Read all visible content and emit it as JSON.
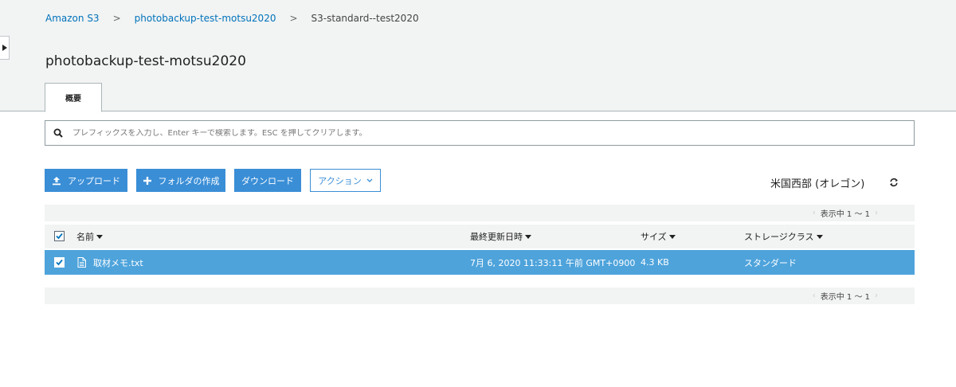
{
  "breadcrumb": {
    "root": "Amazon S3",
    "bucket": "photobackup-test-motsu2020",
    "folder": "S3-standard--test2020",
    "separator": ">"
  },
  "page": {
    "title": "photobackup-test-motsu2020",
    "tab_overview": "概要"
  },
  "search": {
    "placeholder": "プレフィックスを入力し、Enter キーで検索します。ESC を押してクリアします。",
    "value": ""
  },
  "toolbar": {
    "upload_label": "アップロード",
    "create_folder_label": "フォルダの作成",
    "download_label": "ダウンロード",
    "action_label": "アクション",
    "region_label": "米国西部 (オレゴン)"
  },
  "pagination": {
    "top": "表示中 1 ～ 1",
    "bottom": "表示中 1 ～ 1"
  },
  "table": {
    "columns": {
      "name": "名前",
      "last_modified": "最終更新日時",
      "size": "サイズ",
      "storage_class": "ストレージクラス"
    },
    "rows": [
      {
        "name": "取材メモ.txt",
        "last_modified": "7月 6, 2020 11:33:11 午前 GMT+0900",
        "size": "4.3 KB",
        "storage_class": "スタンダード",
        "selected": true
      }
    ]
  },
  "colors": {
    "primary": "#3a8ed6",
    "selected_row": "#4ea3db",
    "link": "#0073bb",
    "header_bg": "#f2f3f3"
  },
  "icons": {
    "search": "search-icon",
    "upload": "upload-icon",
    "add": "plus-icon",
    "refresh": "refresh-icon",
    "file": "file-icon",
    "expand": "caret-right-icon"
  }
}
